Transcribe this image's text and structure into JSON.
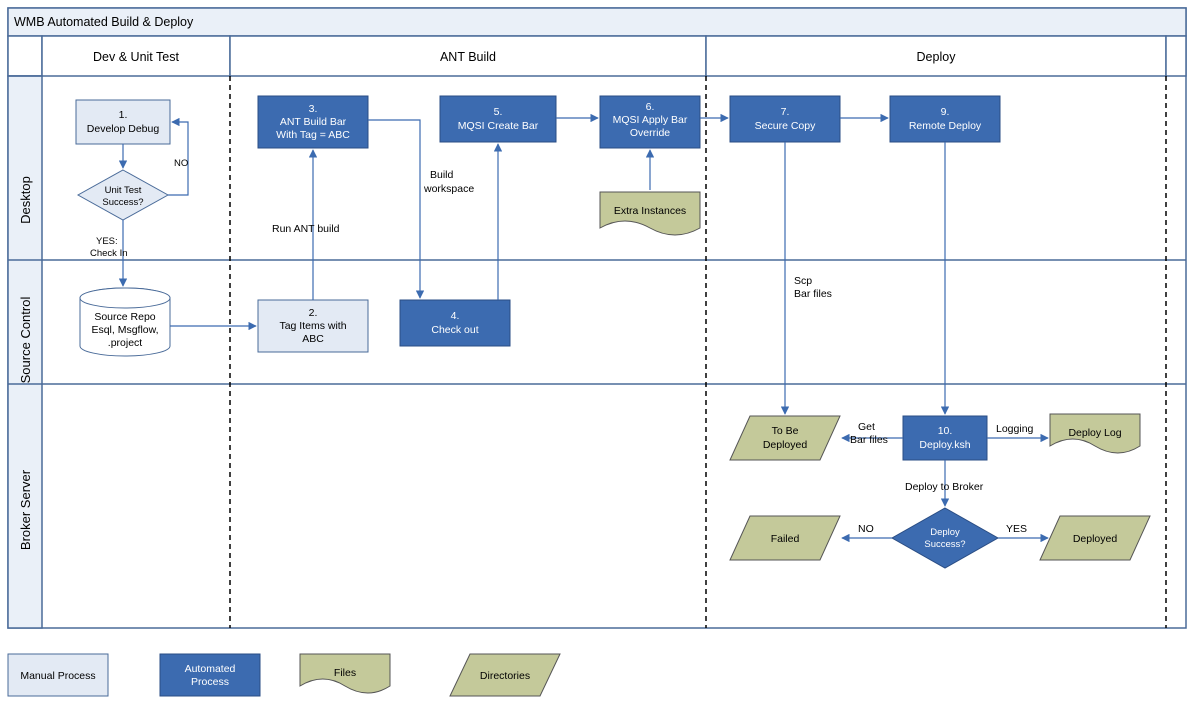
{
  "title": "WMB Automated Build & Deploy",
  "columns": {
    "c1": "Dev & Unit Test",
    "c2": "ANT Build",
    "c3": "Deploy"
  },
  "rows": {
    "r1": "Desktop",
    "r2": "Source Control",
    "r3": "Broker Server"
  },
  "nodes": {
    "n1l1": "1.",
    "n1l2": "Develop Debug",
    "d1l1": "Unit Test",
    "d1l2": "Success?",
    "cyll1": "Source Repo",
    "cyll2": "Esql, Msgflow,",
    "cyll3": ".project",
    "n2l1": "2.",
    "n2l2": "Tag Items with",
    "n2l3": "ABC",
    "n3l1": "3.",
    "n3l2": "ANT Build Bar",
    "n3l3": "With Tag = ABC",
    "n4l1": "4.",
    "n4l2": "Check out",
    "n5l1": "5.",
    "n5l2": "MQSI Create Bar",
    "n6l1": "6.",
    "n6l2": "MQSI Apply Bar",
    "n6l3": "Override",
    "extra": "Extra Instances",
    "n7l1": "7.",
    "n7l2": "Secure Copy",
    "n9l1": "9.",
    "n9l2": "Remote Deploy",
    "tobeDepl1": "To Be",
    "tobeDepl2": "Deployed",
    "n10l1": "10.",
    "n10l2": "Deploy.ksh",
    "deployLog": "Deploy Log",
    "d2l1": "Deploy",
    "d2l2": "Success?",
    "failed": "Failed",
    "deployed": "Deployed"
  },
  "edges": {
    "no": "NO",
    "yes1": "YES:",
    "yes2": "Check In",
    "runAnt": "Run ANT build",
    "buildWs1": "Build",
    "buildWs2": "workspace",
    "scp1": "Scp",
    "scp2": "Bar files",
    "getBar1": "Get",
    "getBar2": "Bar files",
    "logging": "Logging",
    "deployToBroker": "Deploy to Broker",
    "noCap": "NO",
    "yesCap": "YES"
  },
  "legend": {
    "manual": "Manual Process",
    "auto1": "Automated",
    "auto2": "Process",
    "files": "Files",
    "dirs": "Directories"
  }
}
